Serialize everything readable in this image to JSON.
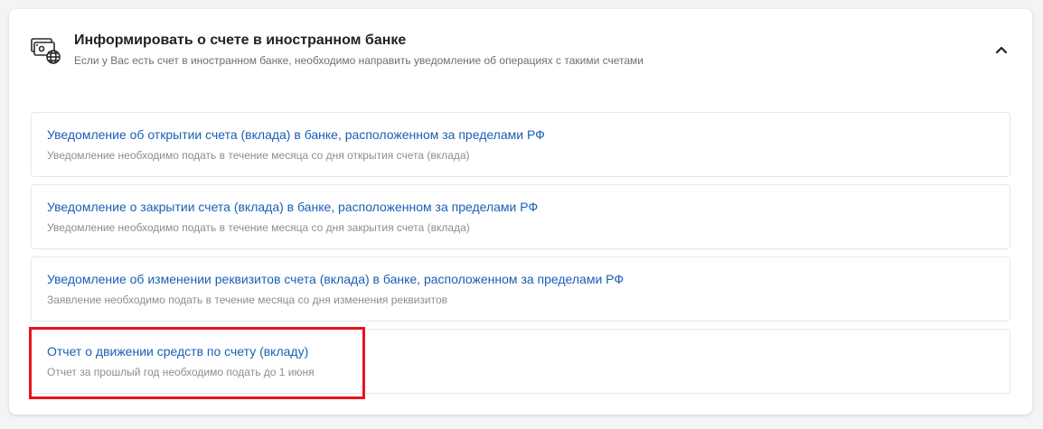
{
  "section": {
    "title": "Информировать о счете в иностранном банке",
    "subtitle": "Если у Вас есть счет в иностранном банке, необходимо направить уведомление об операциях с такими счетами",
    "icon": "bank-card-globe-icon",
    "collapse_icon": "chevron-up-icon"
  },
  "items": [
    {
      "title": "Уведомление об открытии счета (вклада) в банке, расположенном за пределами РФ",
      "description": "Уведомление необходимо подать в течение месяца со дня открытия счета (вклада)"
    },
    {
      "title": "Уведомление о закрытии счета (вклада) в банке, расположенном за пределами РФ",
      "description": "Уведомление необходимо подать в течение месяца со дня закрытия счета (вклада)"
    },
    {
      "title": "Уведомление об изменении реквизитов счета (вклада) в банке, расположенном за пределами РФ",
      "description": "Заявление необходимо подать в течение месяца со дня изменения реквизитов"
    },
    {
      "title": "Отчет о движении средств по счету (вкладу)",
      "description": "Отчет за прошлый год необходимо подать до 1 июня"
    }
  ],
  "colors": {
    "link": "#1a5fb4",
    "highlight": "#e8131e"
  }
}
